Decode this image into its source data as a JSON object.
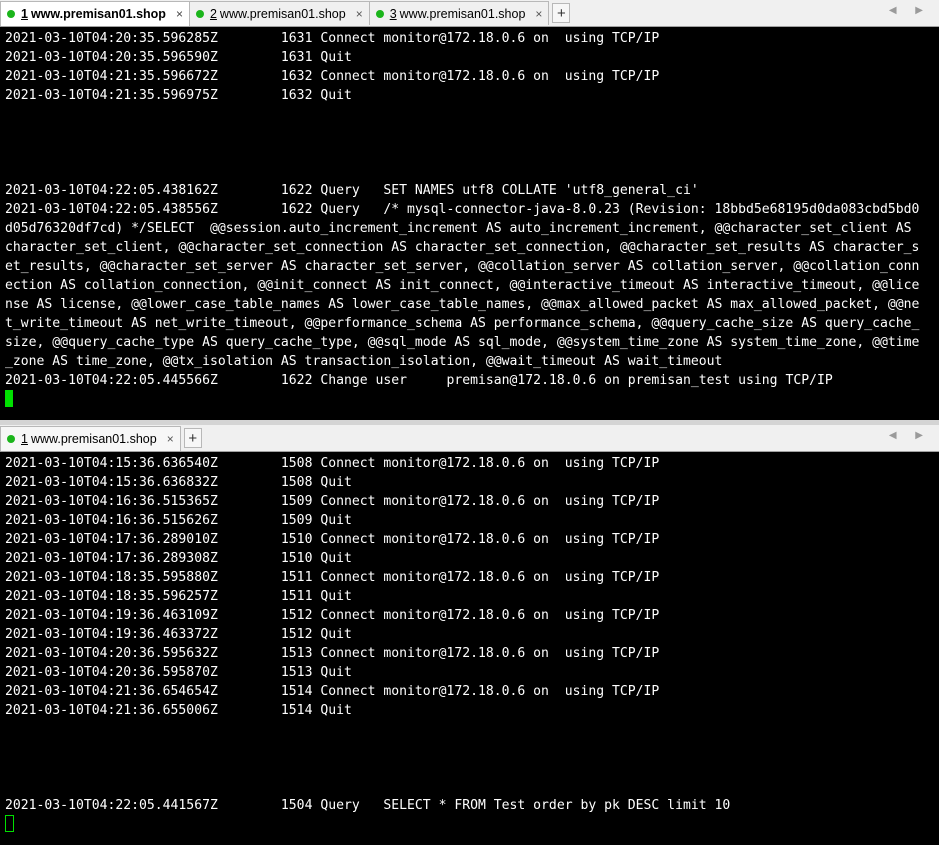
{
  "top_pane": {
    "tabs": [
      {
        "number": "1",
        "label": "www.premisan01.shop",
        "active": true
      },
      {
        "number": "2",
        "label": "www.premisan01.shop",
        "active": false
      },
      {
        "number": "3",
        "label": "www.premisan01.shop",
        "active": false
      }
    ],
    "add_tab_glyph": "+",
    "close_glyph": "×",
    "scroll_glyphs": "◀ ▶",
    "lines": [
      "2021-03-10T04:20:35.596285Z\t   1631 Connect\tmonitor@172.18.0.6 on  using TCP/IP",
      "2021-03-10T04:20:35.596590Z\t   1631 Quit",
      "2021-03-10T04:21:35.596672Z\t   1632 Connect\tmonitor@172.18.0.6 on  using TCP/IP",
      "2021-03-10T04:21:35.596975Z\t   1632 Quit",
      "",
      "",
      "",
      "",
      "2021-03-10T04:22:05.438162Z\t   1622 Query\tSET NAMES utf8 COLLATE 'utf8_general_ci'",
      "2021-03-10T04:22:05.438556Z\t   1622 Query\t/* mysql-connector-java-8.0.23 (Revision: 18bbd5e68195d0da083cbd5bd0",
      "d05d76320df7cd) */SELECT  @@session.auto_increment_increment AS auto_increment_increment, @@character_set_client AS",
      "character_set_client, @@character_set_connection AS character_set_connection, @@character_set_results AS character_s",
      "et_results, @@character_set_server AS character_set_server, @@collation_server AS collation_server, @@collation_conn",
      "ection AS collation_connection, @@init_connect AS init_connect, @@interactive_timeout AS interactive_timeout, @@lice",
      "nse AS license, @@lower_case_table_names AS lower_case_table_names, @@max_allowed_packet AS max_allowed_packet, @@ne",
      "t_write_timeout AS net_write_timeout, @@performance_schema AS performance_schema, @@query_cache_size AS query_cache_",
      "size, @@query_cache_type AS query_cache_type, @@sql_mode AS sql_mode, @@system_time_zone AS system_time_zone, @@time",
      "_zone AS time_zone, @@tx_isolation AS transaction_isolation, @@wait_timeout AS wait_timeout",
      "2021-03-10T04:22:05.445566Z\t   1622 Change user\tpremisan@172.18.0.6 on premisan_test using TCP/IP"
    ]
  },
  "bottom_pane": {
    "tabs": [
      {
        "number": "1",
        "label": "www.premisan01.shop",
        "active": true
      }
    ],
    "add_tab_glyph": "+",
    "close_glyph": "×",
    "scroll_glyphs": "◀ ▶",
    "lines": [
      "2021-03-10T04:15:36.636540Z\t   1508 Connect\tmonitor@172.18.0.6 on  using TCP/IP",
      "2021-03-10T04:15:36.636832Z\t   1508 Quit",
      "2021-03-10T04:16:36.515365Z\t   1509 Connect\tmonitor@172.18.0.6 on  using TCP/IP",
      "2021-03-10T04:16:36.515626Z\t   1509 Quit",
      "2021-03-10T04:17:36.289010Z\t   1510 Connect\tmonitor@172.18.0.6 on  using TCP/IP",
      "2021-03-10T04:17:36.289308Z\t   1510 Quit",
      "2021-03-10T04:18:35.595880Z\t   1511 Connect\tmonitor@172.18.0.6 on  using TCP/IP",
      "2021-03-10T04:18:35.596257Z\t   1511 Quit",
      "2021-03-10T04:19:36.463109Z\t   1512 Connect\tmonitor@172.18.0.6 on  using TCP/IP",
      "2021-03-10T04:19:36.463372Z\t   1512 Quit",
      "2021-03-10T04:20:36.595632Z\t   1513 Connect\tmonitor@172.18.0.6 on  using TCP/IP",
      "2021-03-10T04:20:36.595870Z\t   1513 Quit",
      "2021-03-10T04:21:36.654654Z\t   1514 Connect\tmonitor@172.18.0.6 on  using TCP/IP",
      "2021-03-10T04:21:36.655006Z\t   1514 Quit",
      "",
      "",
      "",
      "",
      "2021-03-10T04:22:05.441567Z\t   1504 Query\tSELECT * FROM Test order by pk DESC limit 10"
    ]
  }
}
